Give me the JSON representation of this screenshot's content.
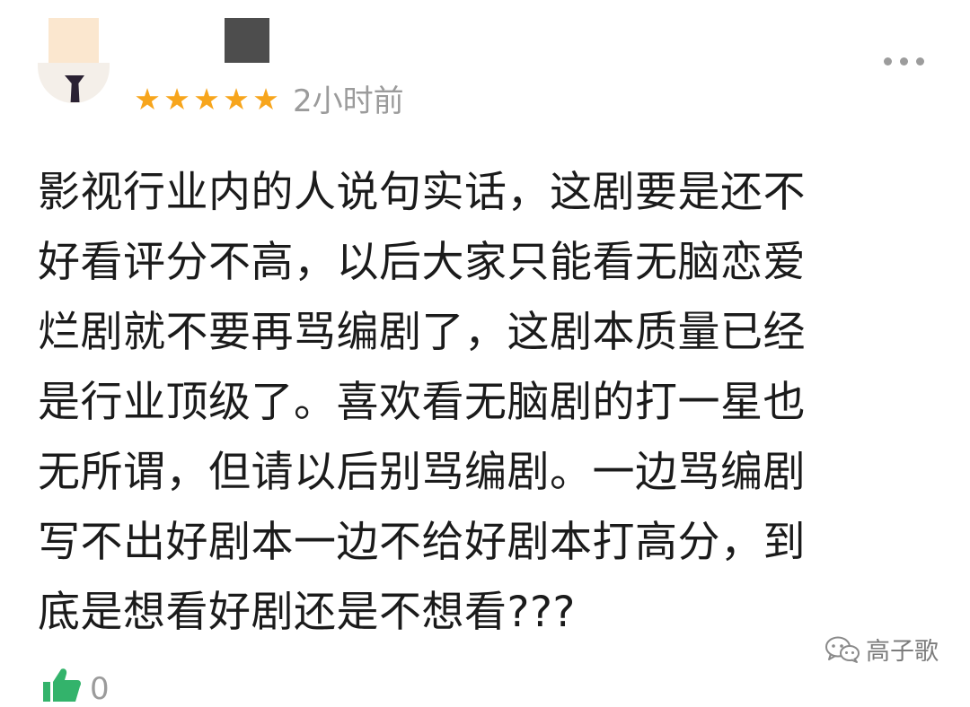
{
  "review": {
    "rating_stars": 5,
    "star_glyphs": [
      "★",
      "★",
      "★",
      "★",
      "★"
    ],
    "time_ago": "2小时前",
    "body_lines": [
      "影视行业内的人说句实话，这剧要是还不",
      "好看评分不高，以后大家只能看无脑恋爱",
      "烂剧就不要再骂编剧了，这剧本质量已经",
      "是行业顶级了。喜欢看无脑剧的打一星也",
      "无所谓，但请以后别骂编剧。一边骂编剧",
      "写不出好剧本一边不给好剧本打高分，到",
      "底是想看好剧还是不想看???"
    ],
    "like_count": "0"
  },
  "watermark": {
    "label": "高子歌",
    "icon": "wechat-icon"
  },
  "colors": {
    "star": "#f7a51c",
    "meta_text": "#9b9b9b",
    "body_text": "#1b1b1b",
    "like_icon": "#33b36b"
  }
}
